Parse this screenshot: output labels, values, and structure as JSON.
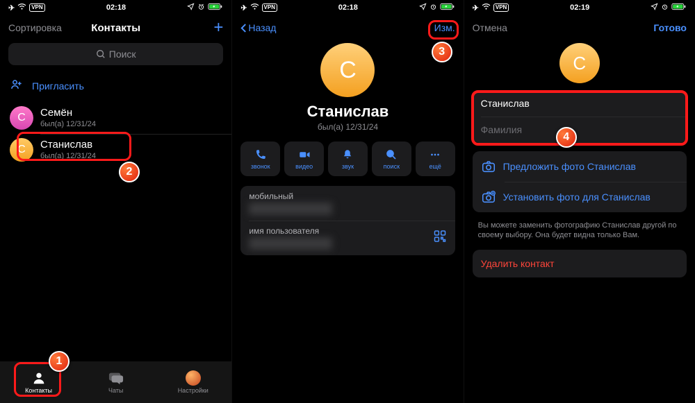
{
  "status": {
    "time": "02:18",
    "time3": "02:19",
    "vpn": "VPN"
  },
  "screen1": {
    "sort": "Сортировка",
    "title": "Контакты",
    "search_placeholder": "Поиск",
    "invite": "Пригласить",
    "contacts": [
      {
        "initial": "С",
        "name": "Семён",
        "sub": "был(а) 12/31/24"
      },
      {
        "initial": "С",
        "name": "Станислав",
        "sub": "был(а) 12/31/24"
      }
    ],
    "tabs": {
      "contacts": "Контакты",
      "chats": "Чаты",
      "settings": "Настройки"
    }
  },
  "screen2": {
    "back": "Назад",
    "edit": "Изм.",
    "avatar_initial": "С",
    "name": "Станислав",
    "sub": "был(а) 12/31/24",
    "actions": {
      "call": "звонок",
      "video": "видео",
      "sound": "звук",
      "search": "поиск",
      "more": "ещё"
    },
    "info": {
      "mobile": "мобильный",
      "username": "имя пользователя"
    }
  },
  "screen3": {
    "cancel": "Отмена",
    "done": "Готово",
    "avatar_initial": "С",
    "first_name": "Станислав",
    "last_name_placeholder": "Фамилия",
    "suggest_photo": "Предложить фото Станислав",
    "set_photo": "Установить фото для Станислав",
    "hint": "Вы можете заменить фотографию Станислав другой по своему выбору. Она будет видна только Вам.",
    "delete": "Удалить контакт"
  }
}
